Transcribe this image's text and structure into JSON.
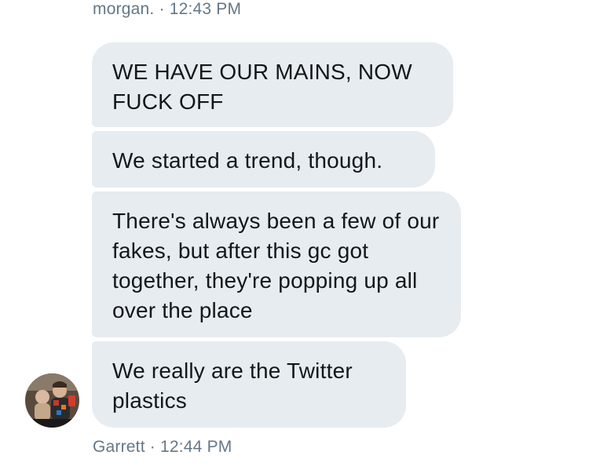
{
  "thread": {
    "header_meta": "morgan. · 12:43 PM",
    "messages": [
      {
        "text": "WE HAVE OUR MAINS, NOW FUCK OFF"
      },
      {
        "text": "We started a trend, though."
      },
      {
        "text": "There's always been a few of our fakes, but after this gc got together, they're popping up all over the place"
      },
      {
        "text": "We really are the Twitter plastics"
      }
    ],
    "footer_meta": "Garrett · 12:44 PM",
    "avatar_icon": "user-avatar-photo",
    "bubble_color": "#e6ecf0",
    "meta_color": "#657786",
    "text_color": "#14171a"
  }
}
